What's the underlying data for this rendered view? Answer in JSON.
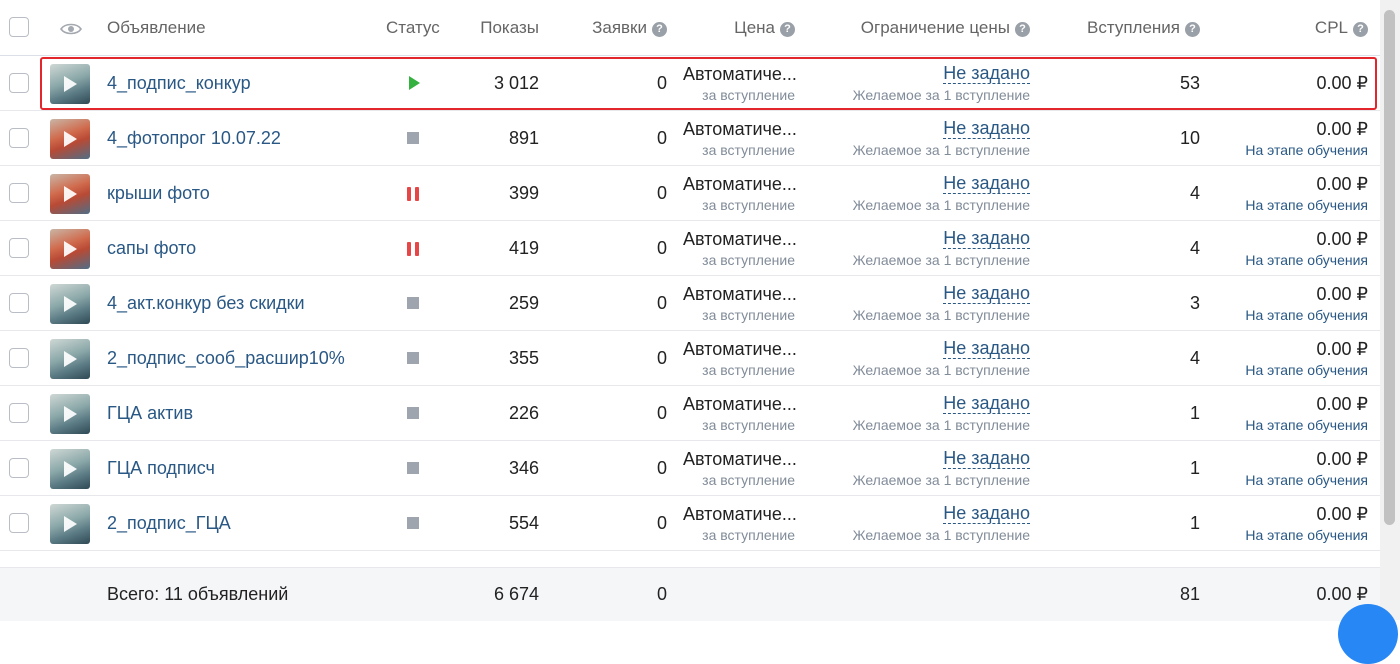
{
  "header": {
    "col_ad": "Объявление",
    "col_status": "Статус",
    "col_shows": "Показы",
    "col_apps": "Заявки",
    "col_price": "Цена",
    "col_limit": "Ограничение цены",
    "col_joins": "Вступления",
    "col_cpl": "CPL",
    "help_glyph": "?"
  },
  "rows": [
    {
      "name": "4_подпис_конкур",
      "status": "active",
      "shows": "3 012",
      "apps": "0",
      "price": "Автоматиче...",
      "price_sub": "за вступление",
      "limit": "Не задано",
      "limit_sub": "Желаемое за 1 вступление",
      "joins": "53",
      "cpl": "0.00 ₽",
      "cpl_sub": "",
      "thumb": "boat"
    },
    {
      "name": "4_фотопрог 10.07.22",
      "status": "stopped",
      "shows": "891",
      "apps": "0",
      "price": "Автоматиче...",
      "price_sub": "за вступление",
      "limit": "Не задано",
      "limit_sub": "Желаемое за 1 вступление",
      "joins": "10",
      "cpl": "0.00 ₽",
      "cpl_sub": "На этапе обучения",
      "thumb": "person"
    },
    {
      "name": "крыши фото",
      "status": "paused",
      "shows": "399",
      "apps": "0",
      "price": "Автоматиче...",
      "price_sub": "за вступление",
      "limit": "Не задано",
      "limit_sub": "Желаемое за 1 вступление",
      "joins": "4",
      "cpl": "0.00 ₽",
      "cpl_sub": "На этапе обучения",
      "thumb": "person"
    },
    {
      "name": "сапы фото",
      "status": "paused",
      "shows": "419",
      "apps": "0",
      "price": "Автоматиче...",
      "price_sub": "за вступление",
      "limit": "Не задано",
      "limit_sub": "Желаемое за 1 вступление",
      "joins": "4",
      "cpl": "0.00 ₽",
      "cpl_sub": "На этапе обучения",
      "thumb": "person"
    },
    {
      "name": "4_акт.конкур без скидки",
      "status": "stopped",
      "shows": "259",
      "apps": "0",
      "price": "Автоматиче...",
      "price_sub": "за вступление",
      "limit": "Не задано",
      "limit_sub": "Желаемое за 1 вступление",
      "joins": "3",
      "cpl": "0.00 ₽",
      "cpl_sub": "На этапе обучения",
      "thumb": "boat"
    },
    {
      "name": "2_подпис_сооб_расшир10%",
      "status": "stopped",
      "shows": "355",
      "apps": "0",
      "price": "Автоматиче...",
      "price_sub": "за вступление",
      "limit": "Не задано",
      "limit_sub": "Желаемое за 1 вступление",
      "joins": "4",
      "cpl": "0.00 ₽",
      "cpl_sub": "На этапе обучения",
      "thumb": "boat"
    },
    {
      "name": "ГЦА актив",
      "status": "stopped",
      "shows": "226",
      "apps": "0",
      "price": "Автоматиче...",
      "price_sub": "за вступление",
      "limit": "Не задано",
      "limit_sub": "Желаемое за 1 вступление",
      "joins": "1",
      "cpl": "0.00 ₽",
      "cpl_sub": "На этапе обучения",
      "thumb": "boat"
    },
    {
      "name": "ГЦА подписч",
      "status": "stopped",
      "shows": "346",
      "apps": "0",
      "price": "Автоматиче...",
      "price_sub": "за вступление",
      "limit": "Не задано",
      "limit_sub": "Желаемое за 1 вступление",
      "joins": "1",
      "cpl": "0.00 ₽",
      "cpl_sub": "На этапе обучения",
      "thumb": "boat"
    },
    {
      "name": "2_подпис_ГЦА",
      "status": "stopped",
      "shows": "554",
      "apps": "0",
      "price": "Автоматиче...",
      "price_sub": "за вступление",
      "limit": "Не задано",
      "limit_sub": "Желаемое за 1 вступление",
      "joins": "1",
      "cpl": "0.00 ₽",
      "cpl_sub": "На этапе обучения",
      "thumb": "boat"
    }
  ],
  "footer": {
    "total_label": "Всего: 11 объявлений",
    "shows": "6 674",
    "apps": "0",
    "joins": "81",
    "cpl": "0.00 ₽"
  },
  "colors": {
    "link": "#2a5885",
    "highlight": "#e3262b",
    "status_active": "#35b13f",
    "status_paused": "#e64646",
    "status_stopped": "#9ea5ae"
  }
}
